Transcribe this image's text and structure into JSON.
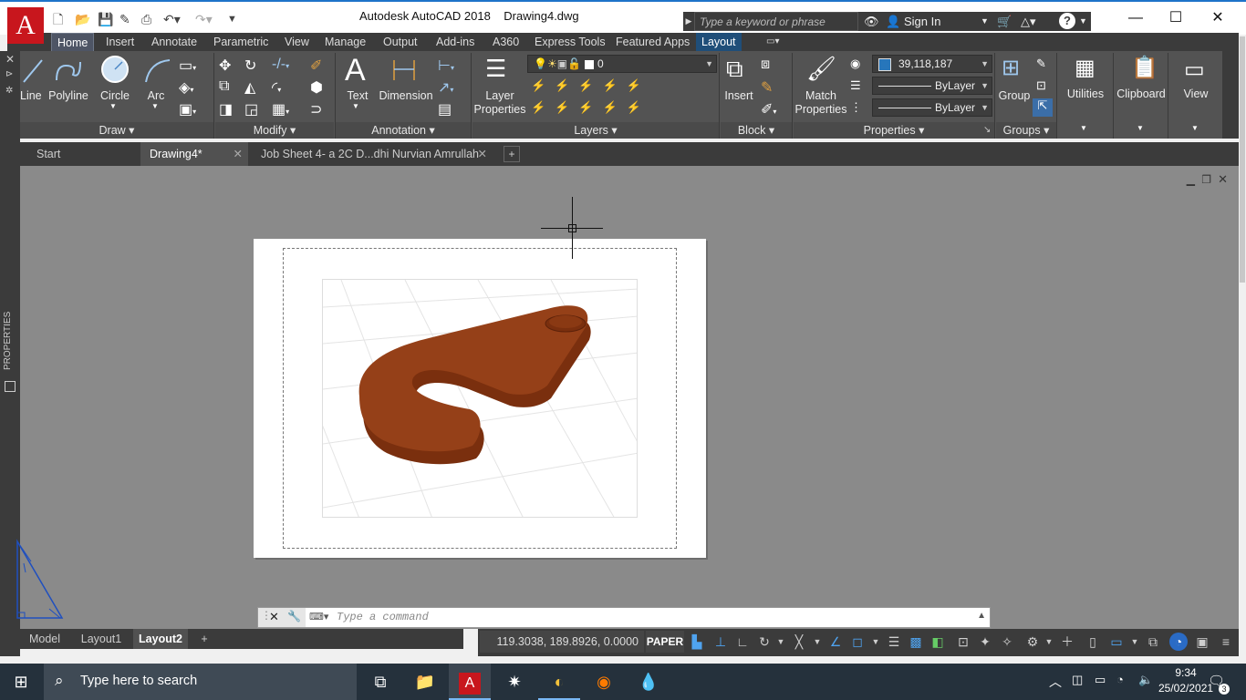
{
  "window": {
    "app_title": "Autodesk AutoCAD 2018",
    "file_name": "Drawing4.dwg",
    "app_letter": "A"
  },
  "search": {
    "placeholder": "Type a keyword or phrase"
  },
  "account": {
    "signin_label": "Sign In"
  },
  "ribbon_tabs": [
    "Home",
    "Insert",
    "Annotate",
    "Parametric",
    "View",
    "Manage",
    "Output",
    "Add-ins",
    "A360",
    "Express Tools",
    "Featured Apps",
    "Layout"
  ],
  "ribbon": {
    "draw": {
      "title": "Draw",
      "line": "Line",
      "polyline": "Polyline",
      "circle": "Circle",
      "arc": "Arc"
    },
    "modify": {
      "title": "Modify"
    },
    "annotation": {
      "title": "Annotation",
      "text": "Text",
      "dimension": "Dimension"
    },
    "layers": {
      "title": "Layers",
      "layer_properties_1": "Layer",
      "layer_properties_2": "Properties",
      "current_layer": "0"
    },
    "block": {
      "title": "Block",
      "insert": "Insert"
    },
    "properties": {
      "title": "Properties",
      "match_1": "Match",
      "match_2": "Properties",
      "color_value": "39,118,187",
      "linetype": "ByLayer",
      "lineweight": "ByLayer"
    },
    "groups": {
      "title": "Groups",
      "group": "Group"
    },
    "utilities": "Utilities",
    "clipboard": "Clipboard",
    "view": "View"
  },
  "file_tabs": [
    {
      "label": "Start"
    },
    {
      "label": "Drawing4*"
    },
    {
      "label": "Job Sheet  4- a 2C D...dhi Nurvian Amrullah"
    }
  ],
  "palette": {
    "properties_label": "PROPERTIES"
  },
  "command": {
    "placeholder": "Type a command"
  },
  "layout_tabs": [
    "Model",
    "Layout1",
    "Layout2"
  ],
  "status": {
    "coordinates": "119.3038, 189.8926, 0.0000",
    "space": "PAPER"
  },
  "taskbar": {
    "search_placeholder": "Type here to search",
    "time": "9:34",
    "date": "25/02/2021",
    "notifications": "3"
  },
  "colors": {
    "accent": "#1e73c9",
    "model_color": "#8f3a12",
    "autocad_red": "#c8161d"
  }
}
